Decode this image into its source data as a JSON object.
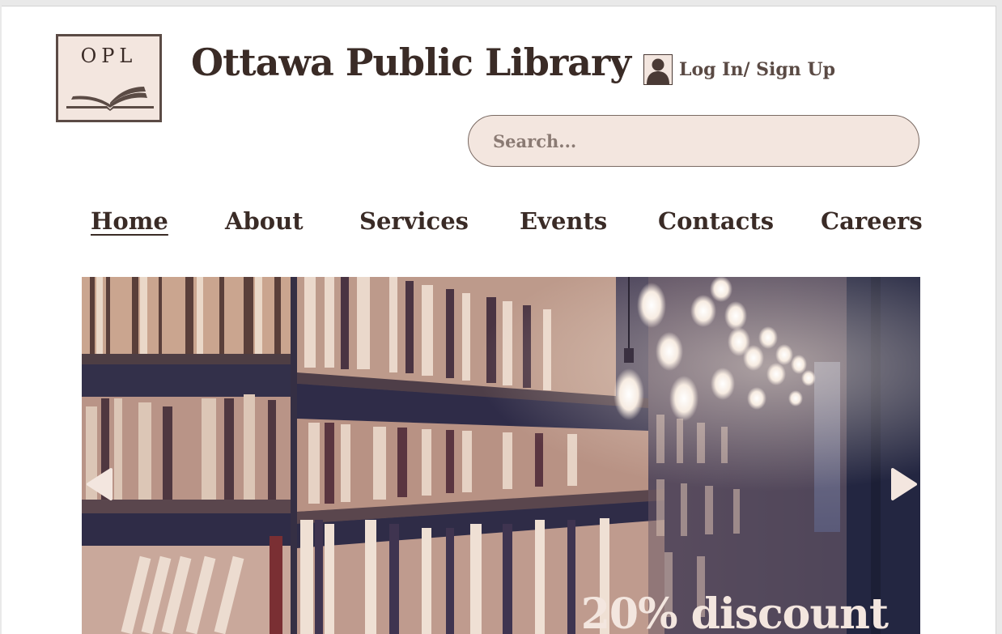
{
  "header": {
    "logo_text": "OPL",
    "title": "Ottawa Public Library",
    "login_label": "Log In/ Sign Up"
  },
  "search": {
    "placeholder": "Search..."
  },
  "nav": {
    "items": [
      {
        "label": "Home",
        "active": true
      },
      {
        "label": "About"
      },
      {
        "label": "Services"
      },
      {
        "label": "Events"
      },
      {
        "label": "Contacts"
      },
      {
        "label": "Careers"
      }
    ]
  },
  "hero": {
    "promo_text": "20% discount",
    "image": "library-bookshelves-with-hanging-bulbs"
  },
  "colors": {
    "primary_text": "#3a2b26",
    "accent_bg": "#f3e6df",
    "border": "#5b4b45"
  }
}
